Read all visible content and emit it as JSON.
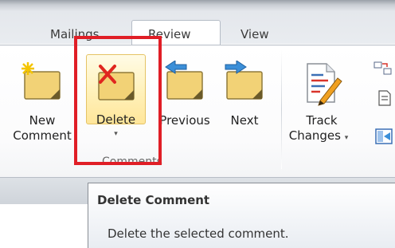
{
  "tabs": [
    "Mailings",
    "Review",
    "View"
  ],
  "active_tab": "Review",
  "group": {
    "label": "Comments",
    "buttons": {
      "new": [
        "New",
        "Comment"
      ],
      "delete": [
        "Delete"
      ],
      "previous": [
        "Previous"
      ],
      "next": [
        "Next"
      ]
    }
  },
  "tracking": {
    "track_changes": [
      "Track",
      "Changes"
    ]
  },
  "dropdown_glyph": "▾",
  "tooltip": {
    "title": "Delete Comment",
    "body": "Delete the selected comment."
  },
  "colors": {
    "highlight": "#e01e26",
    "hover_fill": "#ffe69a",
    "note_fill": "#f2d276"
  },
  "icons": {
    "new_comment": "new-comment-icon",
    "delete_comment": "delete-comment-icon",
    "previous_comment": "previous-comment-icon",
    "next_comment": "next-comment-icon",
    "track_changes": "track-changes-icon"
  }
}
